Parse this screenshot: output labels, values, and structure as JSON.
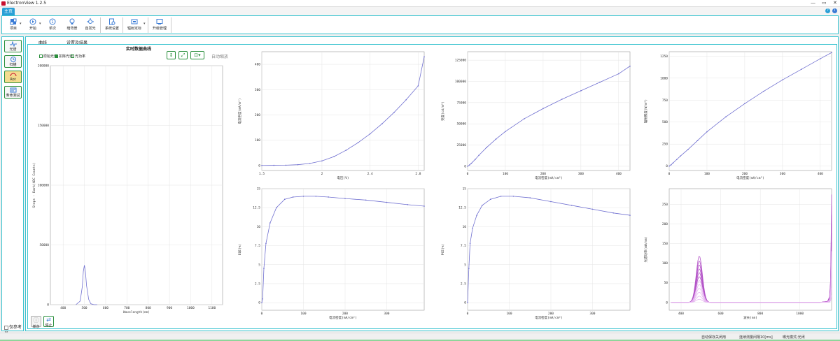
{
  "window": {
    "title": "ElectronView 1.2.5"
  },
  "ribbon_tab": "主页",
  "toolbar": [
    {
      "label": "项目",
      "icon": "project-icon"
    },
    {
      "label": "开始",
      "icon": "play-icon"
    },
    {
      "label": "单次",
      "icon": "single-shot-icon"
    },
    {
      "label": "暗背景",
      "icon": "bulb-icon"
    },
    {
      "label": "自发光",
      "icon": "glow-icon"
    },
    {
      "label": "系统设置",
      "icon": "settings-doc-icon"
    },
    {
      "label": "辐射定标",
      "icon": "calibration-icon"
    },
    {
      "label": "升级管理",
      "icon": "upgrade-icon"
    }
  ],
  "sidebar": {
    "items": [
      {
        "label": "光谱",
        "icon": "spectrum-icon"
      },
      {
        "label": "扫描",
        "icon": "clock-icon"
      },
      {
        "label": "Rot",
        "icon": "rot-icon"
      },
      {
        "label": "寿命测试",
        "icon": "lifetime-icon"
      }
    ],
    "ref_label": "仅参考光"
  },
  "tabs": [
    "曲线",
    "设置及结果"
  ],
  "spectrum": {
    "title": "实时数据曲线",
    "legend": [
      "原始光谱",
      "扣除光谱",
      "光功率"
    ],
    "clear_label": "自动缩放",
    "ylabel": "Steps - Dark(ADC Counts)",
    "xlabel": "Wavelength(nm)"
  },
  "bottom_buttons": [
    {
      "label": "单次",
      "icon": "info-icon"
    },
    {
      "label": "停止",
      "icon": "swap-icon"
    }
  ],
  "status": {
    "save": "自动保存关闭用",
    "interval": "连续测量间隔10[ms]",
    "mode": "曝光模式:光闭"
  },
  "chart_data": [
    {
      "type": "line",
      "title": "实时数据曲线",
      "xlabel": "Wavelength(nm)",
      "ylabel": "Steps - Dark(ADC Counts)",
      "xlim": [
        340,
        1150
      ],
      "ylim": [
        0,
        200000
      ],
      "xticks": [
        400,
        500,
        600,
        700,
        800,
        900,
        1000,
        1100
      ],
      "yticks": [
        0,
        50000,
        100000,
        150000,
        200000
      ],
      "series": [
        {
          "x": [
            460,
            480,
            490,
            495,
            500,
            505,
            510,
            520,
            530,
            545,
            560
          ],
          "values": [
            0,
            3000,
            15000,
            28000,
            33000,
            27000,
            16000,
            4500,
            800,
            0,
            0
          ]
        }
      ],
      "color": "#6f6fd0"
    },
    {
      "type": "line",
      "xlabel": "电压(V)",
      "ylabel": "电流密度(mA/m²)",
      "xlim": [
        1.5,
        2.85
      ],
      "ylim": [
        -20,
        450
      ],
      "xticks": [
        1.5,
        2,
        2.4,
        2.8
      ],
      "yticks": [
        0,
        100,
        200,
        300,
        400
      ],
      "series": [
        {
          "x": [
            1.5,
            1.6,
            1.7,
            1.8,
            1.9,
            2.0,
            2.1,
            2.2,
            2.3,
            2.4,
            2.5,
            2.6,
            2.7,
            2.8,
            2.85
          ],
          "values": [
            0,
            0.5,
            1,
            3,
            8,
            18,
            35,
            60,
            90,
            125,
            165,
            210,
            260,
            315,
            430
          ]
        }
      ],
      "color": "#6f6fd0"
    },
    {
      "type": "line",
      "xlabel": "电流密度(mA/cm²)",
      "ylabel": "亮度(cd/m²)",
      "xlim": [
        0,
        430
      ],
      "ylim": [
        -5000,
        135000
      ],
      "xticks": [
        0,
        100,
        200,
        300,
        400
      ],
      "yticks": [
        0,
        25000,
        50000,
        75000,
        100000,
        125000
      ],
      "series": [
        {
          "x": [
            0,
            5,
            10,
            20,
            30,
            50,
            75,
            100,
            150,
            200,
            250,
            300,
            350,
            400,
            430
          ],
          "values": [
            0,
            1500,
            3500,
            8000,
            13000,
            22000,
            32000,
            41000,
            56000,
            68000,
            79000,
            89000,
            99000,
            109000,
            118000
          ]
        }
      ],
      "color": "#6f6fd0"
    },
    {
      "type": "line",
      "xlabel": "电流密度(mA/cm²)",
      "ylabel": "辐射照度(W/m²)",
      "xlim": [
        0,
        430
      ],
      "ylim": [
        -50,
        1300
      ],
      "xticks": [
        0,
        100,
        200,
        300,
        400
      ],
      "yticks": [
        0,
        250,
        500,
        750,
        1000,
        1250
      ],
      "series": [
        {
          "x": [
            0,
            5,
            10,
            20,
            30,
            50,
            75,
            100,
            150,
            200,
            250,
            300,
            350,
            400,
            430
          ],
          "values": [
            0,
            15,
            35,
            75,
            115,
            190,
            290,
            390,
            560,
            710,
            850,
            980,
            1100,
            1220,
            1290
          ]
        }
      ],
      "color": "#6f6fd0"
    },
    {
      "type": "line",
      "xlabel": "电流密度(mA/cm²)",
      "ylabel": "EQE(%)",
      "xlim": [
        0,
        390
      ],
      "ylim": [
        -1,
        15
      ],
      "xticks": [
        0,
        100,
        200,
        300
      ],
      "yticks": [
        0,
        2.5,
        5,
        7.5,
        10,
        12.5,
        15
      ],
      "series": [
        {
          "x": [
            0,
            2,
            5,
            10,
            20,
            35,
            55,
            75,
            100,
            130,
            160,
            200,
            250,
            300,
            350,
            390
          ],
          "values": [
            0,
            0.5,
            4.5,
            7.8,
            10.5,
            12.5,
            13.6,
            13.9,
            14.0,
            14.0,
            13.9,
            13.7,
            13.5,
            13.2,
            12.9,
            12.7
          ]
        }
      ],
      "color": "#6f6fd0"
    },
    {
      "type": "line",
      "xlabel": "电流密度(mA/cm²)",
      "ylabel": "PCE(%)",
      "xlim": [
        0,
        390
      ],
      "ylim": [
        -1,
        15
      ],
      "xticks": [
        0,
        100,
        200,
        300
      ],
      "yticks": [
        0,
        2.5,
        5,
        7.5,
        10,
        12.5,
        15
      ],
      "series": [
        {
          "x": [
            0,
            3,
            6,
            12,
            22,
            35,
            55,
            80,
            110,
            150,
            200,
            250,
            300,
            350,
            390
          ],
          "values": [
            0,
            4.5,
            7.8,
            9.8,
            11.5,
            12.8,
            13.6,
            14.0,
            14.0,
            13.8,
            13.3,
            12.8,
            12.3,
            11.8,
            11.5
          ]
        }
      ],
      "color": "#6f6fd0"
    },
    {
      "type": "line",
      "xlabel": "波长(nm)",
      "ylabel": "光谱功率(mW/nm)",
      "xlim": [
        340,
        1160
      ],
      "ylim": [
        -20,
        290
      ],
      "xticks": [
        400,
        600,
        800,
        1000
      ],
      "yticks": [
        0,
        50,
        100,
        150,
        200,
        250
      ],
      "series": [
        {
          "peak": 118
        },
        {
          "peak": 106
        },
        {
          "peak": 96
        },
        {
          "peak": 86
        },
        {
          "peak": 76
        },
        {
          "peak": 66
        },
        {
          "peak": 56
        },
        {
          "peak": 46
        },
        {
          "peak": 36
        },
        {
          "peak": 26
        },
        {
          "peak": 16
        },
        {
          "peak": 8
        }
      ],
      "peak_x": 492,
      "tail": {
        "x": [
          1100,
          1140,
          1150,
          1155,
          1158,
          1160
        ],
        "values": [
          0,
          3,
          15,
          60,
          180,
          275
        ]
      },
      "colors": [
        "#b455c8",
        "#e6b6f0"
      ]
    }
  ]
}
